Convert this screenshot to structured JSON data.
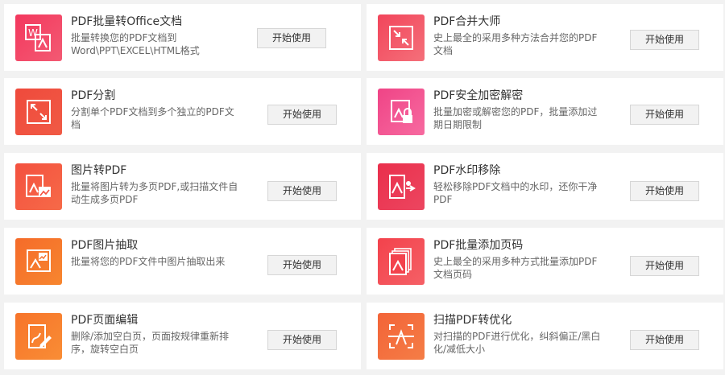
{
  "tools": [
    {
      "title": "PDF批量转Office文档",
      "desc": "批量转换您的PDF文档到Word\\PPT\\EXCEL\\HTML格式",
      "button": "开始使用",
      "icon": "office-convert-icon",
      "color": "#f3385e"
    },
    {
      "title": "PDF合并大师",
      "desc": "史上最全的采用多种方法合并您的PDF文档",
      "button": "开始使用",
      "icon": "merge-icon",
      "color": "#f2455b"
    },
    {
      "title": "PDF分割",
      "desc": "分割单个PDF文档到多个独立的PDF文档",
      "button": "开始使用",
      "icon": "split-icon",
      "color": "#ef4a3c"
    },
    {
      "title": "PDF安全加密解密",
      "desc": "批量加密或解密您的PDF，批量添加过期日期限制",
      "button": "开始使用",
      "icon": "lock-icon",
      "color": "#ef4486"
    },
    {
      "title": "图片转PDF",
      "desc": "批量将图片转为多页PDF,或扫描文件自动生成多页PDF",
      "button": "开始使用",
      "icon": "image-to-pdf-icon",
      "color": "#f4513f"
    },
    {
      "title": "PDF水印移除",
      "desc": "轻松移除PDF文档中的水印，还你干净PDF",
      "button": "开始使用",
      "icon": "watermark-remove-icon",
      "color": "#ea2f4c"
    },
    {
      "title": "PDF图片抽取",
      "desc": "批量将您的PDF文件中图片抽取出来",
      "button": "开始使用",
      "icon": "image-extract-icon",
      "color": "#f56b2a"
    },
    {
      "title": "PDF批量添加页码",
      "desc": "史上最全的采用多种方式批量添加PDF文档页码",
      "button": "开始使用",
      "icon": "page-number-icon",
      "color": "#f3424c"
    },
    {
      "title": "PDF页面编辑",
      "desc": "删除/添加空白页，页面按规律重新排序，旋转空白页",
      "button": "开始使用",
      "icon": "page-edit-icon",
      "color": "#f7742a"
    },
    {
      "title": "扫描PDF转优化",
      "desc": "对扫描的PDF进行优化，纠斜偏正/黑白化/减低大小",
      "button": "开始使用",
      "icon": "scan-optimize-icon",
      "color": "#f36438"
    }
  ]
}
